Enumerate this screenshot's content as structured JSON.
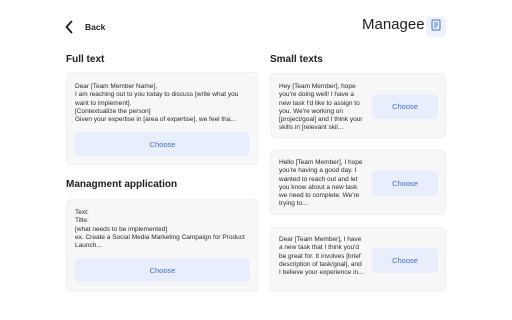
{
  "header": {
    "back_label": "Back",
    "title": "Managee",
    "doc_icon": "document-icon"
  },
  "sections": {
    "full_text": "Full text",
    "managment": "Managment application",
    "small_texts": "Small texts"
  },
  "full_text_card": {
    "text": "Dear [Team Member Name],\nI am reaching out to you today to discuss [write what you want to implement].\n[Contextualize the person]\nGiven your expertise in [area of expertise], we feel tha...",
    "button": "Choose"
  },
  "managment_card": {
    "text": "Text:\nTitle:\n[what needs to be implemented]\nex. Create a Social Media Marketing Campaign for Product Launch...",
    "button": "Choose"
  },
  "small_cards": [
    {
      "text": "Hey [Team Member], hope you're doing well! I have a new task I'd like to assign to you. We're working on [project/goal] and I think your skills in [relevant skil...",
      "button": "Choose"
    },
    {
      "text": "Hello [Team Member], I hope you're having a good day. I wanted to reach out and let you know about a new task we need to complete. We're trying to...",
      "button": "Choose"
    },
    {
      "text": "Dear [Team Member], I have a new task that I think you'd be great for. It involves [brief description of task/goal], and I believe your experience in...",
      "button": "Choose"
    }
  ],
  "colors": {
    "accent": "#3d6be0",
    "button_bg": "#e8eefc",
    "card_bg": "#f7f7f8"
  }
}
